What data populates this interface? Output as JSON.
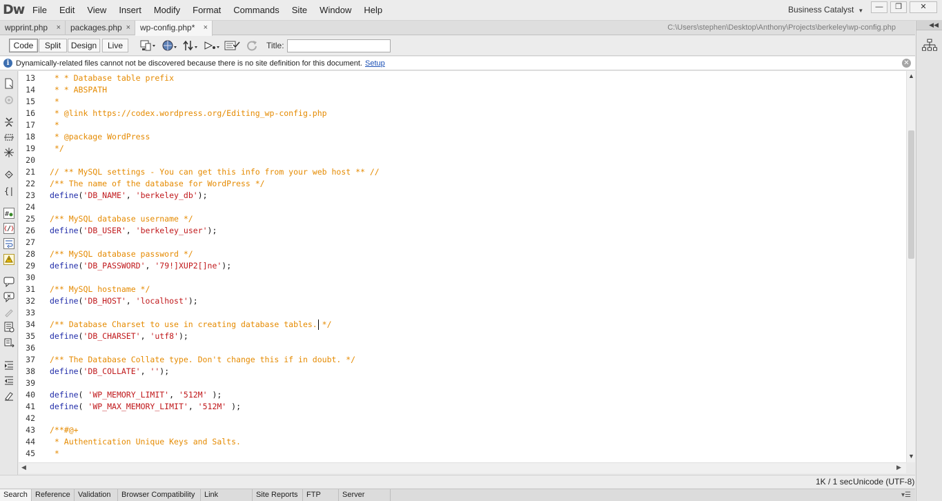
{
  "app": {
    "logo": "Dw",
    "menus": [
      "File",
      "Edit",
      "View",
      "Insert",
      "Modify",
      "Format",
      "Commands",
      "Site",
      "Window",
      "Help"
    ],
    "workspace": "Business Catalyst",
    "window_controls": {
      "minimize": "—",
      "restore": "❐",
      "close": "✕"
    }
  },
  "tabs": [
    {
      "label": "wpprint.php",
      "close": "×"
    },
    {
      "label": "packages.php",
      "close": "×"
    },
    {
      "label": "wp-config.php*",
      "close": "×"
    }
  ],
  "doc_path": "C:\\Users\\stephen\\Desktop\\Anthony\\Projects\\berkeley\\wp-config.php",
  "toolbar": {
    "views": [
      "Code",
      "Split",
      "Design",
      "Live"
    ],
    "title_label": "Title:",
    "title_value": "",
    "icons": [
      "multiscreen-icon",
      "preview-globe-icon",
      "file-management-icon",
      "visual-aids-icon",
      "validate-markup-icon",
      "refresh-icon"
    ]
  },
  "infobar": {
    "message": "Dynamically-related files cannot not be discovered because there is no site definition for this document.",
    "link": "Setup",
    "icon": "info-icon"
  },
  "editor": {
    "lines": [
      {
        "n": "13",
        "tokens": [
          {
            "t": " * * Database table prefix",
            "c": "cmt"
          }
        ]
      },
      {
        "n": "14",
        "tokens": [
          {
            "t": " * * ABSPATH",
            "c": "cmt"
          }
        ]
      },
      {
        "n": "15",
        "tokens": [
          {
            "t": " *",
            "c": "cmt"
          }
        ]
      },
      {
        "n": "16",
        "tokens": [
          {
            "t": " * @link https://codex.wordpress.org/Editing_wp-config.php",
            "c": "cmt"
          }
        ]
      },
      {
        "n": "17",
        "tokens": [
          {
            "t": " *",
            "c": "cmt"
          }
        ]
      },
      {
        "n": "18",
        "tokens": [
          {
            "t": " * @package WordPress",
            "c": "cmt"
          }
        ]
      },
      {
        "n": "19",
        "tokens": [
          {
            "t": " */",
            "c": "cmt"
          }
        ]
      },
      {
        "n": "20",
        "tokens": []
      },
      {
        "n": "21",
        "tokens": [
          {
            "t": "// ** MySQL settings - You can get this info from your web host ** //",
            "c": "cmt"
          }
        ]
      },
      {
        "n": "22",
        "tokens": [
          {
            "t": "/** The name of the database for WordPress */",
            "c": "cmt"
          }
        ]
      },
      {
        "n": "23",
        "tokens": [
          {
            "t": "define",
            "c": "kw"
          },
          {
            "t": "(",
            "c": "pun"
          },
          {
            "t": "'DB_NAME'",
            "c": "str"
          },
          {
            "t": ", ",
            "c": "pun"
          },
          {
            "t": "'berkeley_db'",
            "c": "str"
          },
          {
            "t": ");",
            "c": "pun"
          }
        ]
      },
      {
        "n": "24",
        "tokens": []
      },
      {
        "n": "25",
        "tokens": [
          {
            "t": "/** MySQL database username */",
            "c": "cmt"
          }
        ]
      },
      {
        "n": "26",
        "tokens": [
          {
            "t": "define",
            "c": "kw"
          },
          {
            "t": "(",
            "c": "pun"
          },
          {
            "t": "'DB_USER'",
            "c": "str"
          },
          {
            "t": ", ",
            "c": "pun"
          },
          {
            "t": "'berkeley_user'",
            "c": "str"
          },
          {
            "t": ");",
            "c": "pun"
          }
        ]
      },
      {
        "n": "27",
        "tokens": []
      },
      {
        "n": "28",
        "tokens": [
          {
            "t": "/** MySQL database password */",
            "c": "cmt"
          }
        ]
      },
      {
        "n": "29",
        "tokens": [
          {
            "t": "define",
            "c": "kw"
          },
          {
            "t": "(",
            "c": "pun"
          },
          {
            "t": "'DB_PASSWORD'",
            "c": "str"
          },
          {
            "t": ", ",
            "c": "pun"
          },
          {
            "t": "'79!]XUP2[]ne'",
            "c": "str"
          },
          {
            "t": ");",
            "c": "pun"
          }
        ]
      },
      {
        "n": "30",
        "tokens": []
      },
      {
        "n": "31",
        "tokens": [
          {
            "t": "/** MySQL hostname */",
            "c": "cmt"
          }
        ]
      },
      {
        "n": "32",
        "tokens": [
          {
            "t": "define",
            "c": "kw"
          },
          {
            "t": "(",
            "c": "pun"
          },
          {
            "t": "'DB_HOST'",
            "c": "str"
          },
          {
            "t": ", ",
            "c": "pun"
          },
          {
            "t": "'localhost'",
            "c": "str"
          },
          {
            "t": ");",
            "c": "pun"
          }
        ]
      },
      {
        "n": "33",
        "tokens": []
      },
      {
        "n": "34",
        "tokens": [
          {
            "t": "/** Database Charset to use in creating database tables. */",
            "c": "cmt"
          }
        ]
      },
      {
        "n": "35",
        "tokens": [
          {
            "t": "define",
            "c": "kw"
          },
          {
            "t": "(",
            "c": "pun"
          },
          {
            "t": "'DB_CHARSET'",
            "c": "str"
          },
          {
            "t": ", ",
            "c": "pun"
          },
          {
            "t": "'utf8'",
            "c": "str"
          },
          {
            "t": ");",
            "c": "pun"
          }
        ]
      },
      {
        "n": "36",
        "tokens": []
      },
      {
        "n": "37",
        "tokens": [
          {
            "t": "/** The Database Collate type. Don't change this if in doubt. */",
            "c": "cmt"
          }
        ]
      },
      {
        "n": "38",
        "tokens": [
          {
            "t": "define",
            "c": "kw"
          },
          {
            "t": "(",
            "c": "pun"
          },
          {
            "t": "'DB_COLLATE'",
            "c": "str"
          },
          {
            "t": ", ",
            "c": "pun"
          },
          {
            "t": "''",
            "c": "str"
          },
          {
            "t": ");",
            "c": "pun"
          }
        ]
      },
      {
        "n": "39",
        "tokens": []
      },
      {
        "n": "40",
        "tokens": [
          {
            "t": "define",
            "c": "kw"
          },
          {
            "t": "( ",
            "c": "pun"
          },
          {
            "t": "'WP_MEMORY_LIMIT'",
            "c": "str"
          },
          {
            "t": ", ",
            "c": "pun"
          },
          {
            "t": "'512M'",
            "c": "str"
          },
          {
            "t": " );",
            "c": "pun"
          }
        ]
      },
      {
        "n": "41",
        "tokens": [
          {
            "t": "define",
            "c": "kw"
          },
          {
            "t": "( ",
            "c": "pun"
          },
          {
            "t": "'WP_MAX_MEMORY_LIMIT'",
            "c": "str"
          },
          {
            "t": ", ",
            "c": "pun"
          },
          {
            "t": "'512M'",
            "c": "str"
          },
          {
            "t": " );",
            "c": "pun"
          }
        ]
      },
      {
        "n": "42",
        "tokens": []
      },
      {
        "n": "43",
        "tokens": [
          {
            "t": "/**#@+",
            "c": "cmt"
          }
        ]
      },
      {
        "n": "44",
        "tokens": [
          {
            "t": " * Authentication Unique Keys and Salts.",
            "c": "cmt"
          }
        ]
      },
      {
        "n": "45",
        "tokens": [
          {
            "t": " *",
            "c": "cmt"
          }
        ]
      }
    ]
  },
  "status": {
    "size": "1K / 1 sec",
    "encoding": "Unicode (UTF-8)"
  },
  "panel_tabs": [
    "Search",
    "Reference",
    "Validation",
    "Browser Compatibility",
    "Link Checker",
    "Site Reports",
    "FTP Log",
    "Server Debug"
  ],
  "colors": {
    "comment": "#e58a00",
    "keyword": "#1e2aa8",
    "string": "#c0181b",
    "link": "#1a4fb5"
  }
}
